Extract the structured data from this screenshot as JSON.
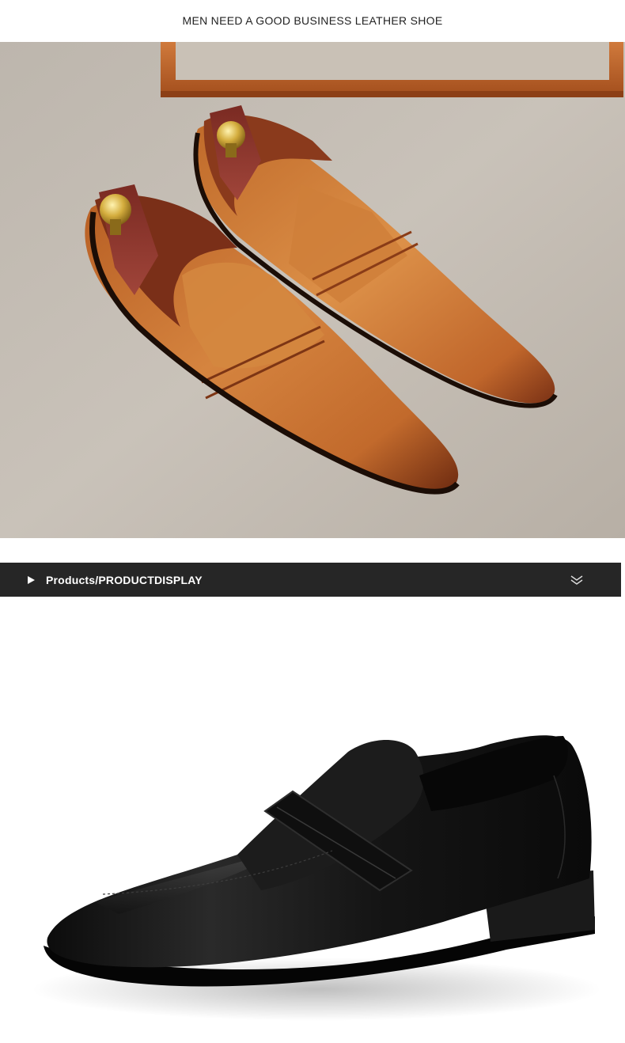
{
  "header": {
    "title": "MEN NEED A GOOD BUSINESS LEATHER SHOE"
  },
  "hero": {
    "alt": "Two tan leather penny loafers with wooden shoe trees on a grey leather surface"
  },
  "section_bar": {
    "label": "Products/PRODUCTDISPLAY",
    "play_icon": "play-icon",
    "expand_icon": "double-chevron-down-icon"
  },
  "product": {
    "alt": "Black leather penny loafer side view"
  },
  "colors": {
    "bar_bg": "#262626",
    "tan_leather": "#c46a2c",
    "black_leather": "#141414"
  }
}
